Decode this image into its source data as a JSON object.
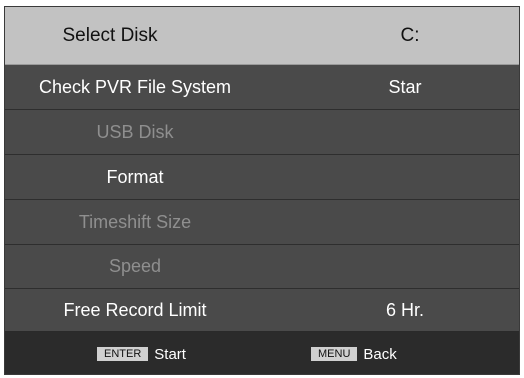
{
  "header": {
    "label": "Select Disk",
    "value": "C:"
  },
  "menu": {
    "check_pvr": {
      "label": "Check PVR File System",
      "value": "Star"
    },
    "usb_disk": {
      "label": "USB Disk"
    },
    "format": {
      "label": "Format"
    },
    "timeshift_size": {
      "label": "Timeshift Size"
    },
    "speed": {
      "label": "Speed"
    },
    "free_record_limit": {
      "label": "Free Record Limit",
      "value": "6 Hr."
    }
  },
  "footer": {
    "enter_key": "ENTER",
    "enter_action": "Start",
    "menu_key": "MENU",
    "menu_action": "Back"
  },
  "colors": {
    "header_bg": "#c2c2c2",
    "row_bg": "#4a4a4a",
    "footer_bg": "#2b2b2b",
    "disabled_text": "#8f8f8f"
  }
}
